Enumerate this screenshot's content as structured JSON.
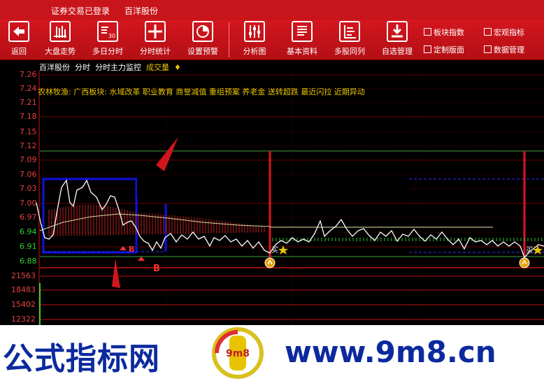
{
  "titlebar": {
    "login_status": "证券交易已登录",
    "stock_name": "百洋股份"
  },
  "toolbar": {
    "buttons": [
      {
        "label": "返回",
        "icon": "back-arrow-icon"
      },
      {
        "label": "大盘走势",
        "icon": "market-trend-icon"
      },
      {
        "label": "多日分时",
        "icon": "multi-day-icon",
        "badge": "30"
      },
      {
        "label": "分时统计",
        "icon": "grid-stats-icon"
      },
      {
        "label": "设置预警",
        "icon": "pie-alert-icon"
      },
      {
        "label": "分析图",
        "icon": "sliders-icon"
      },
      {
        "label": "基本资料",
        "icon": "document-icon"
      },
      {
        "label": "多股同列",
        "icon": "multi-stock-icon"
      },
      {
        "label": "自选管理",
        "icon": "download-icon"
      }
    ],
    "small_buttons": [
      "板块指数",
      "宏观指标",
      "定制版面",
      "数据管理"
    ]
  },
  "info_line": {
    "stock": "百洋股份",
    "mode1": "分时",
    "mode2": "分时主力监控",
    "mode3": "成交量",
    "toggle": "♦"
  },
  "tag_line": "农林牧渔: 广西板块: 水域改革 职业教育 商誉减值 重组预案 养老金 送转超跌 最近闪拉 近期异动",
  "price_axis": [
    "7.26",
    "7.24",
    "7.21",
    "7.18",
    "7.15",
    "7.12",
    "7.09",
    "7.06",
    "7.03",
    "7.00",
    "6.97",
    "6.94",
    "6.91",
    "6.88"
  ],
  "volume_axis": [
    "21563",
    "18483",
    "15402",
    "12322"
  ],
  "annotations": {
    "label_b1": "B",
    "label_b2": "B",
    "buy1": "买",
    "buy2": "买"
  },
  "colors": {
    "toolbar": "#c8141b",
    "price_axis_up": "#e84040",
    "price_axis_down": "#30d030",
    "accent_yellow": "#e8c400",
    "chart_red": "#e0161b",
    "chart_blue": "#1010e0"
  },
  "banner": {
    "left_text": "公式指标网",
    "right_text": "www.9m8.cn",
    "logo_text": "9m8"
  }
}
